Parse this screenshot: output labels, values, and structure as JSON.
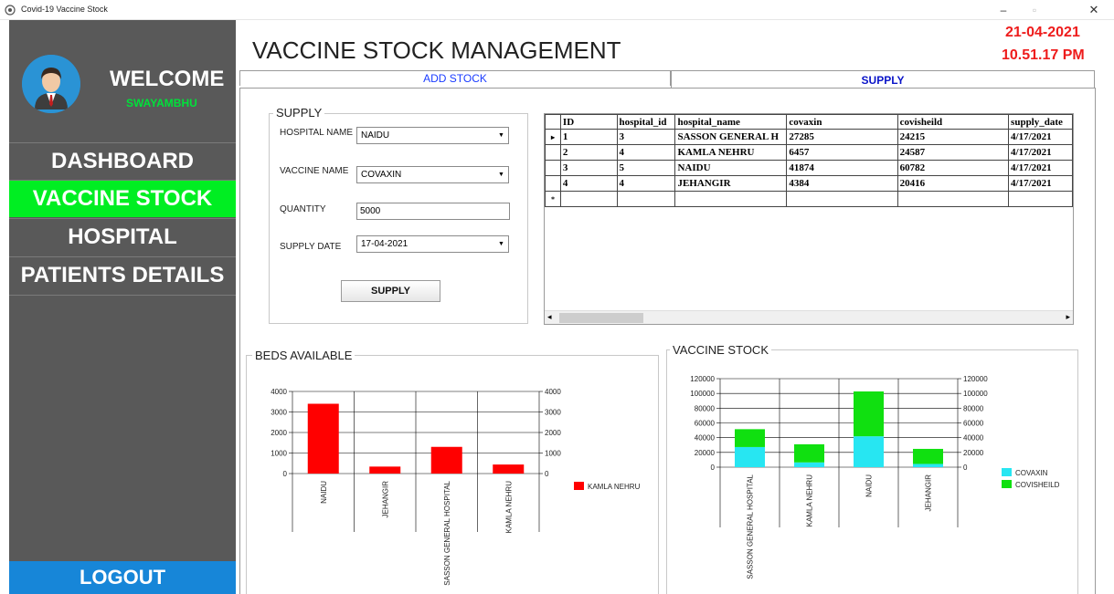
{
  "window": {
    "title": "Covid-19 Vaccine Stock",
    "min_icon": "minimize-icon",
    "max_icon": "maximize-icon",
    "close_icon": "close-icon"
  },
  "sidebar": {
    "welcome": "WELCOME",
    "username": "SWAYAMBHU",
    "items": [
      {
        "label": "DASHBOARD"
      },
      {
        "label": "VACCINE STOCK"
      },
      {
        "label": "HOSPITAL"
      },
      {
        "label": "PATIENTS DETAILS"
      }
    ],
    "logout": "LOGOUT",
    "colors": {
      "bg": "#595959",
      "active": "#00ee22",
      "logout": "#1786d8",
      "username": "#00e13a"
    }
  },
  "header": {
    "title": "VACCINE STOCK MANAGEMENT",
    "date": "21-04-2021",
    "time": "10.51.17 PM"
  },
  "tabs": [
    {
      "label": "ADD STOCK"
    },
    {
      "label": "SUPPLY"
    }
  ],
  "supply_form": {
    "group_title": "SUPPLY",
    "hospital_label": "HOSPITAL NAME",
    "hospital_value": "NAIDU",
    "vaccine_label": "VACCINE NAME",
    "vaccine_value": "COVAXIN",
    "quantity_label": "QUANTITY",
    "quantity_value": "5000",
    "date_label": "SUPPLY DATE",
    "date_value": "17-04-2021",
    "button": "SUPPLY"
  },
  "supply_table": {
    "columns": [
      "ID",
      "hospital_id",
      "hospital_name",
      "covaxin",
      "covisheild",
      "supply_date"
    ],
    "rows": [
      [
        "1",
        "3",
        "SASSON GENERAL H",
        "27285",
        "24215",
        "4/17/2021"
      ],
      [
        "2",
        "4",
        "KAMLA NEHRU",
        "6457",
        "24587",
        "4/17/2021"
      ],
      [
        "3",
        "5",
        "NAIDU",
        "41874",
        "60782",
        "4/17/2021"
      ],
      [
        "4",
        "4",
        "JEHANGIR",
        "4384",
        "20416",
        "4/17/2021"
      ]
    ],
    "current_row_marker": "▸",
    "new_row_marker": "*"
  },
  "chart_data": [
    {
      "type": "bar",
      "title": "BEDS AVAILABLE",
      "categories": [
        "NAIDU",
        "JEHANGIR",
        "SASSON GENERAL HOSPITAL",
        "KAMLA NEHRU"
      ],
      "series": [
        {
          "name": "KAMLA NEHRU",
          "values": [
            3400,
            340,
            1300,
            440
          ],
          "color": "#ff0000"
        }
      ],
      "yticks": [
        0,
        1000,
        2000,
        3000,
        4000
      ],
      "ylim": [
        0,
        4000
      ],
      "legend": "right"
    },
    {
      "type": "bar",
      "stacked": true,
      "title": "VACCINE STOCK",
      "categories": [
        "SASSON GENERAL HOSPITAL",
        "KAMLA NEHRU",
        "NAIDU",
        "JEHANGIR"
      ],
      "series": [
        {
          "name": "COVAXIN",
          "values": [
            27285,
            6457,
            41874,
            4384
          ],
          "color": "#27e6f2"
        },
        {
          "name": "COVISHEILD",
          "values": [
            24215,
            24587,
            60782,
            20416
          ],
          "color": "#10e010"
        }
      ],
      "yticks": [
        0,
        20000,
        40000,
        60000,
        80000,
        100000,
        120000
      ],
      "ylim": [
        0,
        120000
      ],
      "legend": "right"
    }
  ]
}
